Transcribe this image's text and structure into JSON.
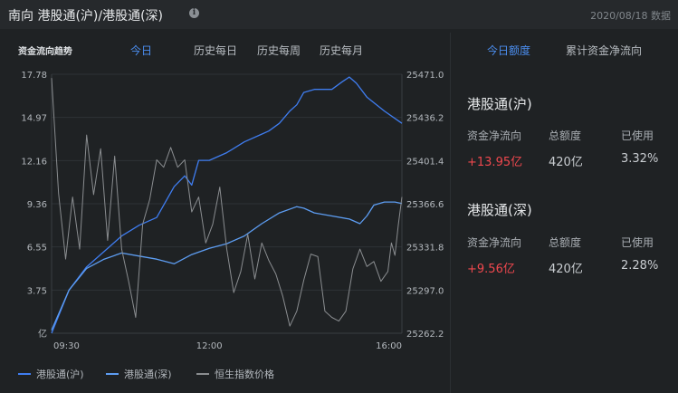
{
  "header": {
    "title": "南向  港股通(沪)/港股通(深)",
    "info_icon": "info-circle-icon",
    "date": "2020/08/18 数据"
  },
  "chart_panel": {
    "label": "资金流向趋势",
    "tabs": [
      {
        "label": "今日",
        "active": true
      },
      {
        "label": "历史每日",
        "active": false
      },
      {
        "label": "历史每周",
        "active": false
      },
      {
        "label": "历史每月",
        "active": false
      }
    ]
  },
  "chart_data": {
    "type": "line",
    "x_ticks": [
      "09:30",
      "12:00",
      "16:00"
    ],
    "left_axis": {
      "ticks": [
        "17.78",
        "14.97",
        "12.16",
        "9.36",
        "6.55",
        "3.75"
      ],
      "unit": "亿",
      "range": [
        1.0,
        17.78
      ]
    },
    "right_axis": {
      "ticks": [
        "25471.0",
        "25436.2",
        "25401.4",
        "25366.6",
        "25331.8",
        "25297.0",
        "25262.2"
      ],
      "range": [
        25262.2,
        25471.0
      ]
    },
    "series": [
      {
        "name": "港股通(沪)",
        "color": "#3f7df0",
        "axis": "left",
        "x": [
          0,
          0.05,
          0.1,
          0.15,
          0.2,
          0.25,
          0.3,
          0.35,
          0.38,
          0.4,
          0.42,
          0.45,
          0.5,
          0.55,
          0.6,
          0.62,
          0.65,
          0.68,
          0.7,
          0.72,
          0.75,
          0.8,
          0.83,
          0.85,
          0.87,
          0.9,
          0.95,
          1.0
        ],
        "values": [
          1.0,
          3.8,
          5.3,
          6.3,
          7.3,
          8.0,
          8.5,
          10.5,
          11.2,
          10.6,
          12.2,
          12.2,
          12.7,
          13.4,
          13.9,
          14.1,
          14.6,
          15.4,
          15.8,
          16.6,
          16.8,
          16.8,
          17.3,
          17.6,
          17.2,
          16.3,
          15.4,
          14.6
        ]
      },
      {
        "name": "港股通(深)",
        "color": "#5d9df2",
        "axis": "left",
        "x": [
          0,
          0.05,
          0.1,
          0.15,
          0.2,
          0.25,
          0.3,
          0.35,
          0.4,
          0.45,
          0.5,
          0.55,
          0.6,
          0.65,
          0.7,
          0.72,
          0.75,
          0.8,
          0.85,
          0.88,
          0.9,
          0.92,
          0.95,
          0.98,
          1.0
        ],
        "values": [
          1.2,
          3.8,
          5.2,
          5.8,
          6.2,
          6.0,
          5.8,
          5.5,
          6.1,
          6.5,
          6.8,
          7.3,
          8.1,
          8.8,
          9.2,
          9.1,
          8.8,
          8.6,
          8.4,
          8.1,
          8.6,
          9.3,
          9.5,
          9.5,
          9.4
        ]
      },
      {
        "name": "恒生指数价格",
        "color": "#8a8d90",
        "axis": "right",
        "x": [
          0,
          0.02,
          0.04,
          0.06,
          0.08,
          0.1,
          0.12,
          0.14,
          0.16,
          0.18,
          0.2,
          0.22,
          0.24,
          0.26,
          0.28,
          0.3,
          0.32,
          0.34,
          0.36,
          0.38,
          0.4,
          0.42,
          0.44,
          0.46,
          0.48,
          0.5,
          0.52,
          0.54,
          0.56,
          0.58,
          0.6,
          0.62,
          0.64,
          0.66,
          0.68,
          0.7,
          0.72,
          0.74,
          0.76,
          0.78,
          0.8,
          0.82,
          0.84,
          0.86,
          0.88,
          0.9,
          0.92,
          0.94,
          0.96,
          0.97,
          0.98,
          0.99,
          1.0
        ],
        "values": [
          25468,
          25375,
          25322,
          25372,
          25330,
          25422,
          25374,
          25411,
          25337,
          25405,
          25330,
          25304,
          25275,
          25350,
          25370,
          25402,
          25396,
          25412,
          25396,
          25402,
          25360,
          25372,
          25335,
          25350,
          25380,
          25330,
          25295,
          25312,
          25342,
          25306,
          25335,
          25321,
          25310,
          25292,
          25268,
          25280,
          25305,
          25326,
          25324,
          25280,
          25275,
          25272,
          25280,
          25314,
          25330,
          25316,
          25320,
          25304,
          25312,
          25335,
          25325,
          25350,
          25372
        ]
      }
    ]
  },
  "right_panel": {
    "tabs": [
      {
        "label": "今日额度",
        "active": true
      },
      {
        "label": "累计资金净流向",
        "active": false
      }
    ],
    "sections": [
      {
        "title": "港股通(沪)",
        "headers": [
          "资金净流向",
          "总额度",
          "已使用"
        ],
        "values": [
          "+13.95亿",
          "420亿",
          "3.32%"
        ]
      },
      {
        "title": "港股通(深)",
        "headers": [
          "资金净流向",
          "总额度",
          "已使用"
        ],
        "values": [
          "+9.56亿",
          "420亿",
          "2.28%"
        ]
      }
    ]
  }
}
